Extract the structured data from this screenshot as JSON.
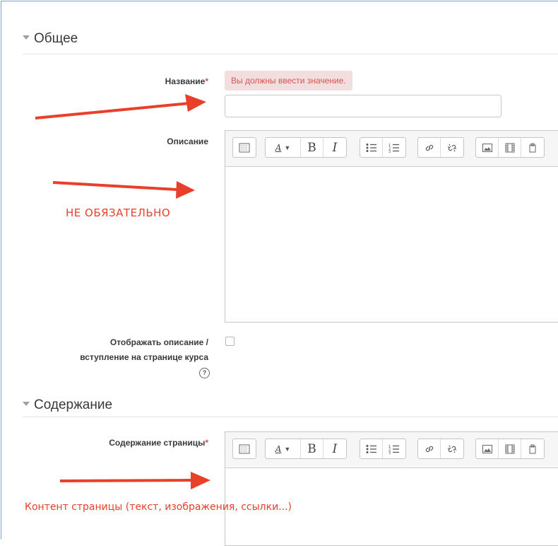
{
  "sections": {
    "general": {
      "title": "Общее"
    },
    "content": {
      "title": "Содержание"
    }
  },
  "fields": {
    "name": {
      "label": "Название",
      "required_mark": "*",
      "error": "Вы должны ввести значение.",
      "value": ""
    },
    "description": {
      "label": "Описание"
    },
    "show_description": {
      "label_line1": "Отображать описание /",
      "label_line2": "вступление на странице курса",
      "checked": false
    },
    "page_content": {
      "label": "Содержание страницы",
      "required_mark": "*"
    }
  },
  "editor_toolbar": {
    "buttons": [
      "toolbar-toggle",
      "font-color",
      "bold",
      "italic",
      "unordered-list",
      "ordered-list",
      "link",
      "unlink",
      "image",
      "media",
      "manage-files"
    ]
  },
  "annotations": {
    "optional_note": "НЕ ОБЯЗАТЕЛЬНО",
    "content_note": "Контент страницы (текст, изображения, ссылки...)"
  },
  "colors": {
    "arrow": "#e8402a",
    "required": "#d9534f",
    "error_bg": "#f2dede"
  }
}
